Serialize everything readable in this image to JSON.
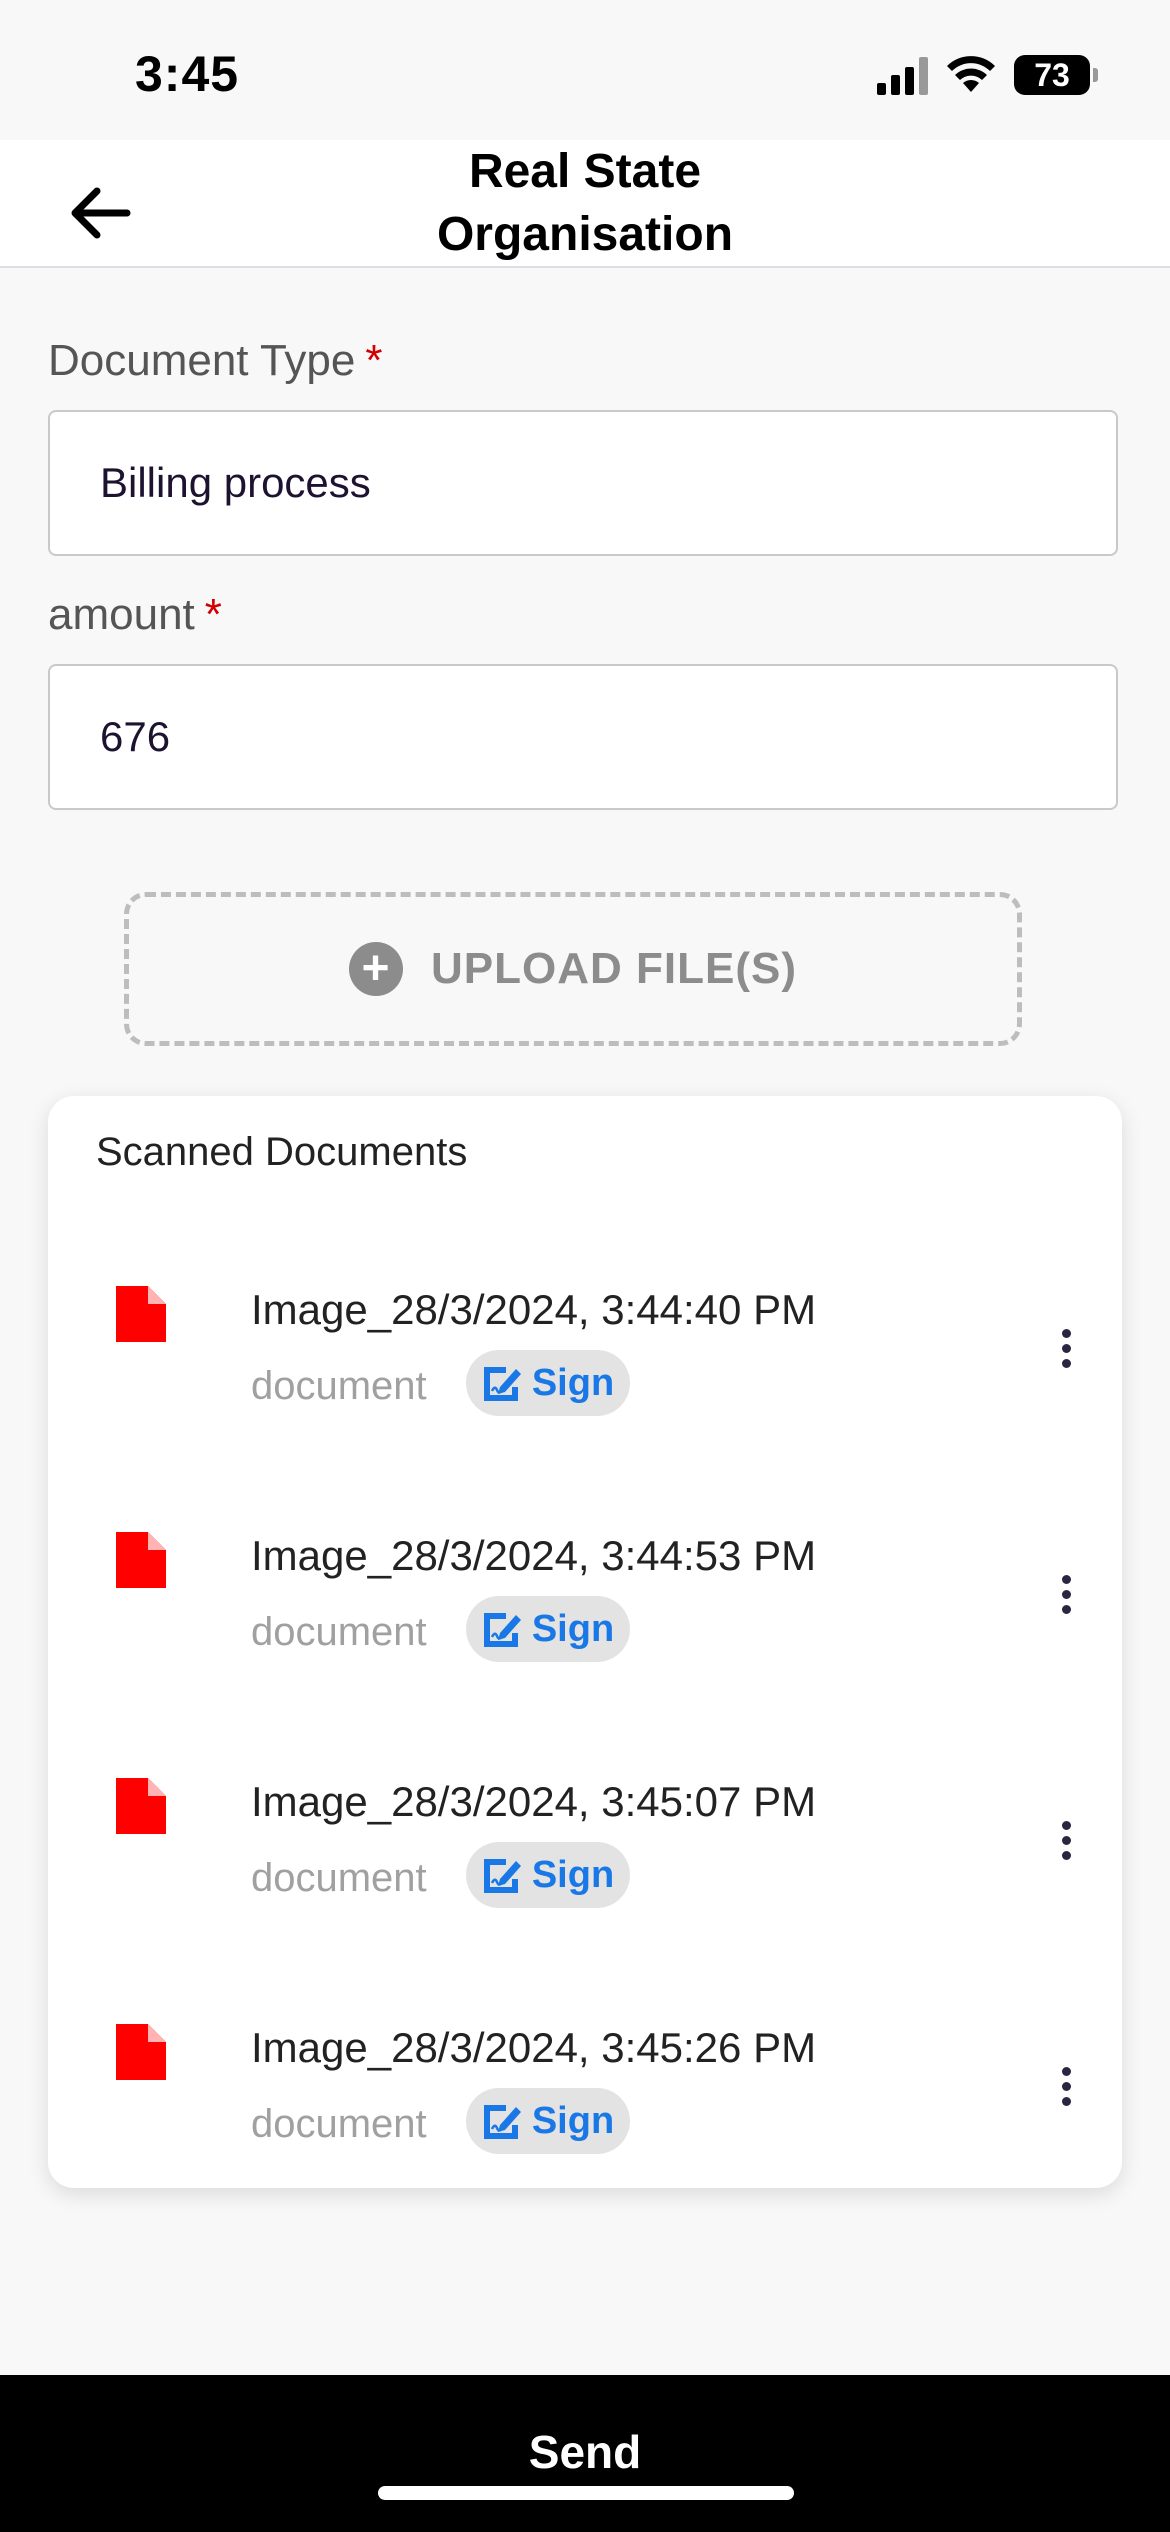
{
  "status_bar": {
    "time": "3:45",
    "battery": "73"
  },
  "header": {
    "title_line1": "Real State",
    "title_line2": "Organisation",
    "back_icon": "arrow-left-icon"
  },
  "form": {
    "document_type": {
      "label": "Document Type",
      "required_mark": "*",
      "value": "Billing process"
    },
    "amount": {
      "label": "amount",
      "required_mark": "*",
      "value": "676"
    },
    "upload": {
      "label": "UPLOAD FILE(S)",
      "icon": "plus-circle-icon"
    }
  },
  "scanned": {
    "title": "Scanned Documents",
    "items": [
      {
        "name": "Image_28/3/2024, 3:44:40 PM",
        "type": "document",
        "sign_label": "Sign"
      },
      {
        "name": "Image_28/3/2024, 3:44:53 PM",
        "type": "document",
        "sign_label": "Sign"
      },
      {
        "name": "Image_28/3/2024, 3:45:07 PM",
        "type": "document",
        "sign_label": "Sign"
      },
      {
        "name": "Image_28/3/2024, 3:45:26 PM",
        "type": "document",
        "sign_label": "Sign"
      }
    ]
  },
  "footer": {
    "send_label": "Send"
  },
  "colors": {
    "accent_blue": "#1a78e6",
    "required_red": "#d40000",
    "doc_icon_red": "#ff0000",
    "send_bar": "#000000"
  }
}
